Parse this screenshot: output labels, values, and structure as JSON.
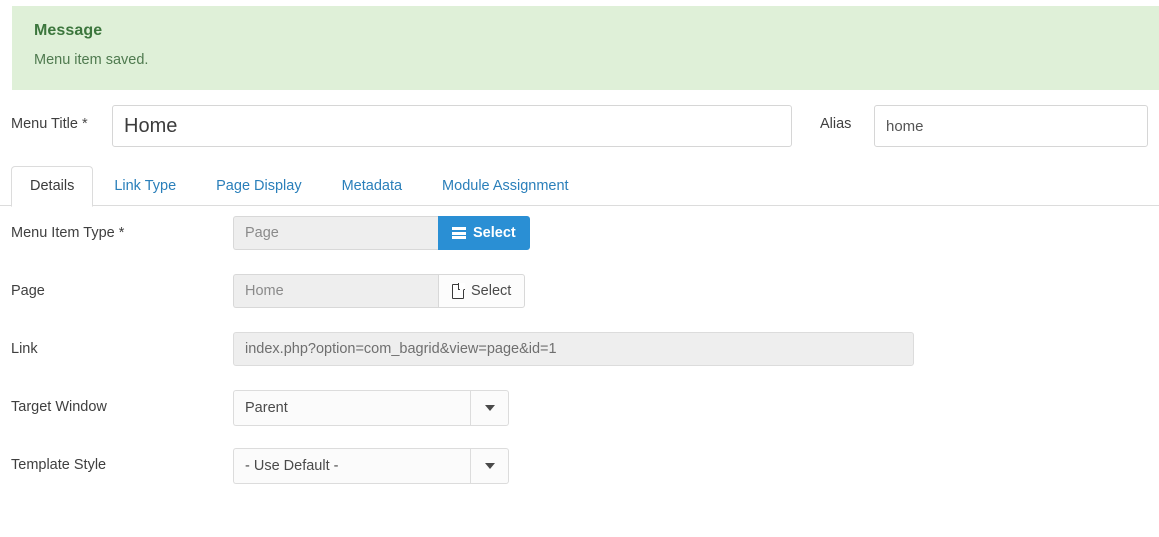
{
  "alert": {
    "title": "Message",
    "text": "Menu item saved.",
    "bg_color": "#dff0d8",
    "title_color": "#3c763d"
  },
  "header": {
    "menu_title_label": "Menu Title",
    "menu_title_required": "*",
    "menu_title_value": "Home",
    "alias_label": "Alias",
    "alias_value": "home"
  },
  "tabs": [
    {
      "label": "Details",
      "active": true
    },
    {
      "label": "Link Type",
      "active": false
    },
    {
      "label": "Page Display",
      "active": false
    },
    {
      "label": "Metadata",
      "active": false
    },
    {
      "label": "Module Assignment",
      "active": false
    }
  ],
  "form": {
    "menu_item_type": {
      "label": "Menu Item Type",
      "required": "*",
      "value": "Page",
      "button_label": "Select",
      "button_icon": "list-icon",
      "button_color": "#2a8fd4"
    },
    "page": {
      "label": "Page",
      "value": "Home",
      "button_label": "Select",
      "button_icon": "file-icon"
    },
    "link": {
      "label": "Link",
      "value": "index.php?option=com_bagrid&view=page&id=1"
    },
    "target_window": {
      "label": "Target Window",
      "value": "Parent"
    },
    "template_style": {
      "label": "Template Style",
      "value": "- Use Default -"
    }
  }
}
